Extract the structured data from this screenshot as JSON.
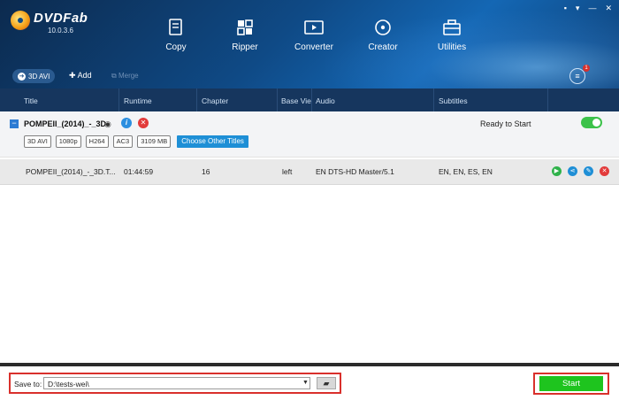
{
  "app": {
    "logo_text": "DVDFab",
    "version": "10.0.3.6",
    "window_controls": [
      "▪",
      "▾",
      "—",
      "✕"
    ]
  },
  "modules": [
    {
      "label": "Copy",
      "icon": "copy-icon"
    },
    {
      "label": "Ripper",
      "icon": "ripper-icon"
    },
    {
      "label": "Converter",
      "icon": "converter-icon"
    },
    {
      "label": "Creator",
      "icon": "creator-icon"
    },
    {
      "label": "Utilities",
      "icon": "utilities-icon"
    }
  ],
  "toolbar": {
    "profile_label": "3D AVI",
    "add_label": "Add",
    "merge_label": "Merge",
    "queue_badge": "1"
  },
  "columns": [
    "Title",
    "Runtime",
    "Chapter",
    "Base Vie",
    "Audio",
    "Subtitles"
  ],
  "title_item": {
    "name": "POMPEII_(2014)_-_3D",
    "status": "Ready to Start",
    "tags": [
      "3D AVI",
      "1080p",
      "H264",
      "AC3",
      "3109 MB"
    ],
    "choose_label": "Choose Other Titles",
    "enabled": true
  },
  "track": {
    "title": "POMPEII_(2014)_-_3D.T...",
    "runtime": "01:44:59",
    "chapter": "16",
    "base_view": "left",
    "audio": "EN  DTS-HD Master/5.1",
    "subtitles": "EN, EN, ES, EN"
  },
  "save": {
    "label": "Save to:",
    "path": "D:\\tests-wei\\"
  },
  "start_label": "Start",
  "colors": {
    "header_bg": "#0f4a86",
    "column_header_bg": "#16365e",
    "start_green": "#1ec41e",
    "highlight_red": "#d9302c"
  }
}
